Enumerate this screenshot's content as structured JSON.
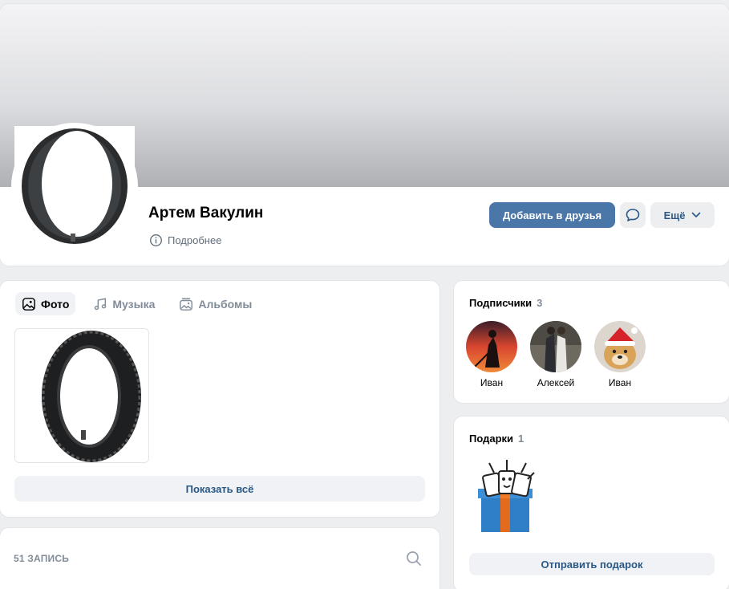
{
  "profile": {
    "name": "Артем Вакулин",
    "more_info_label": "Подробнее",
    "add_friend_label": "Добавить в друзья",
    "more_label": "Ещё"
  },
  "media": {
    "tabs": [
      {
        "label": "Фото",
        "icon": "photo-icon",
        "active": true
      },
      {
        "label": "Музыка",
        "icon": "music-icon",
        "active": false
      },
      {
        "label": "Альбомы",
        "icon": "album-icon",
        "active": false
      }
    ],
    "show_all_label": "Показать всё"
  },
  "posts": {
    "count_label": "51 ЗАПИСЬ"
  },
  "subscribers": {
    "title": "Подписчики",
    "count": "3",
    "items": [
      {
        "name": "Иван"
      },
      {
        "name": "Алексей"
      },
      {
        "name": "Иван"
      }
    ]
  },
  "gifts": {
    "title": "Подарки",
    "count": "1",
    "send_label": "Отправить подарок"
  },
  "colors": {
    "accent": "#4a76a8",
    "link": "#2a5885",
    "muted": "#818c99",
    "background": "#edeef0"
  }
}
